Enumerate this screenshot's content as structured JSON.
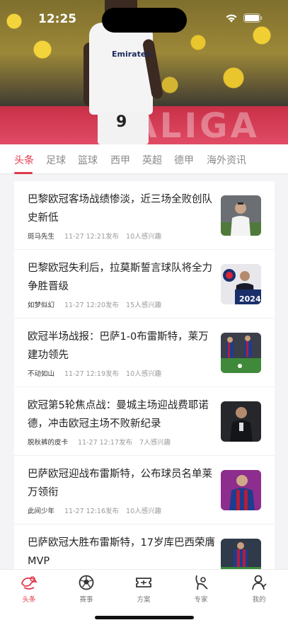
{
  "status_bar": {
    "time": "12:25"
  },
  "hero": {
    "board_text": "LALIGA",
    "shirt_sponsor": "Emirates",
    "shirt_number": "9"
  },
  "tabs": [
    {
      "label": "头条",
      "active": true
    },
    {
      "label": "足球"
    },
    {
      "label": "篮球"
    },
    {
      "label": "西甲"
    },
    {
      "label": "英超"
    },
    {
      "label": "德甲"
    },
    {
      "label": "海外资讯"
    }
  ],
  "news": [
    {
      "title": "巴黎欧冠客场战绩惨淡，近三场全败创队史新低",
      "author": "斑马先生",
      "time": "11-27 12:21发布",
      "interest": "10人感兴趣"
    },
    {
      "title": "巴黎欧冠失利后，拉莫斯誓言球队将全力争胜晋级",
      "author": "如梦似幻",
      "time": "11-27 12:20发布",
      "interest": "15人感兴趣"
    },
    {
      "title": "欧冠半场战报：巴萨1-0布雷斯特，莱万建功领先",
      "author": "不动如山",
      "time": "11-27 12:19发布",
      "interest": "10人感兴趣"
    },
    {
      "title": "欧冠第5轮焦点战：曼城主场迎战费耶诺德，冲击欧冠主场不败新纪录",
      "author": "脱秋裤的皮卡",
      "time": "11-27 12:17发布",
      "interest": "7人感兴趣"
    },
    {
      "title": "巴萨欧冠迎战布雷斯特，公布球员名单莱万领衔",
      "author": "此间少年",
      "time": "11-27 12:16发布",
      "interest": "10人感兴趣"
    },
    {
      "title": "巴萨欧冠大胜布雷斯特，17岁库巴西荣膺MVP",
      "author": "",
      "time": "",
      "interest": ""
    }
  ],
  "thumb_texts": {
    "psg_banner": "2024"
  },
  "tabbar": [
    {
      "label": "头条",
      "icon": "headline-icon",
      "active": true
    },
    {
      "label": "赛事",
      "icon": "soccer-ball-icon"
    },
    {
      "label": "方案",
      "icon": "ticket-icon"
    },
    {
      "label": "专家",
      "icon": "expert-icon"
    },
    {
      "label": "我的",
      "icon": "profile-icon"
    }
  ],
  "colors": {
    "accent": "#e0384c",
    "text": "#222222",
    "muted": "#9a9a9a"
  }
}
